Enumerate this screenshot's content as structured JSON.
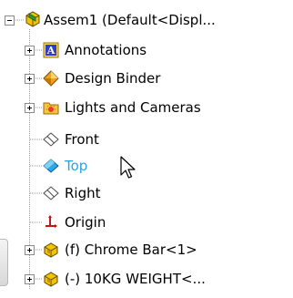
{
  "feature_tree": {
    "root": {
      "label": "Assem1  (Default<Displ...",
      "icon": "assembly-icon"
    },
    "items": [
      {
        "label": "Annotations",
        "icon": "annotations-icon",
        "expander": "plus"
      },
      {
        "label": "Design Binder",
        "icon": "design-binder-icon",
        "expander": "plus"
      },
      {
        "label": "Lights and Cameras",
        "icon": "lights-cameras-icon",
        "expander": "plus"
      },
      {
        "label": "Front",
        "icon": "plane-icon",
        "expander": "none"
      },
      {
        "label": "Top",
        "icon": "plane-icon",
        "expander": "none",
        "selected": true
      },
      {
        "label": "Right",
        "icon": "plane-icon",
        "expander": "none"
      },
      {
        "label": "Origin",
        "icon": "origin-icon",
        "expander": "none"
      },
      {
        "label": "(f) Chrome Bar<1>",
        "icon": "part-icon",
        "expander": "plus"
      },
      {
        "label": "(-) 10KG WEIGHT<...",
        "icon": "part-icon",
        "expander": "plus"
      }
    ]
  },
  "colors": {
    "selected_text": "#1ea7e6",
    "tree_line": "#8a8a8a"
  }
}
